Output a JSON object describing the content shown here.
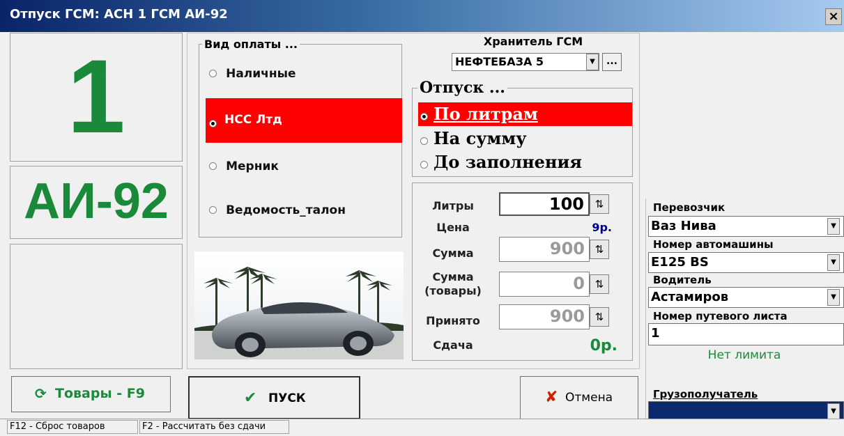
{
  "window": {
    "title": "Отпуск ГСМ:  АСН 1  ГСМ АИ-92",
    "close_glyph": "×"
  },
  "pump": {
    "number": "1",
    "fuel": "АИ-92"
  },
  "payment": {
    "legend": "Вид оплаты ...",
    "options": [
      {
        "label": "Наличные",
        "selected": false
      },
      {
        "label": "НСС Лтд",
        "selected": true
      },
      {
        "label": "Мерник",
        "selected": false
      },
      {
        "label": "Ведомость_талон",
        "selected": false
      }
    ]
  },
  "storage": {
    "label": "Хранитель ГСМ",
    "value": "НЕФТЕБАЗА 5",
    "browse_label": "..."
  },
  "dispense": {
    "legend": "Отпуск ...",
    "options": [
      {
        "label": "По литрам",
        "selected": true
      },
      {
        "label": "На сумму",
        "selected": false
      },
      {
        "label": "До заполнения",
        "selected": false
      }
    ]
  },
  "calc": {
    "liters_label": "Литры",
    "liters_value": "100",
    "price_label": "Цена",
    "price_value": "9р.",
    "sum_label": "Сумма",
    "sum_value": "900",
    "goods_sum_label": "Сумма (товары)",
    "goods_sum_value": "0",
    "accepted_label": "Принято",
    "accepted_value": "900",
    "change_label": "Сдача",
    "change_value": "0р."
  },
  "right_panel": {
    "carrier_label": "Перевозчик",
    "carrier_value": "Ваз Нива",
    "vehicle_label": "Номер автомашины",
    "vehicle_value": "Е125 BS",
    "driver_label": "Водитель",
    "driver_value": "Астамиров",
    "waybill_label": "Номер путевого листа",
    "waybill_value": "1",
    "limit_text": "Нет лимита",
    "consignee_label": "Грузополучатель",
    "consignee_value": ""
  },
  "buttons": {
    "goods": "Товары - F9",
    "start": "ПУСК",
    "cancel": "Отмена"
  },
  "status": {
    "hint1": "F12 - Сброс товаров",
    "hint2": "F2 - Рассчитать без сдачи"
  },
  "colors": {
    "accent_green": "#1a8a3a",
    "selected_red": "#ff0000",
    "title_blue": "#0a246a",
    "price_blue": "#00008b",
    "consignee_navy": "#0b2a6e"
  }
}
